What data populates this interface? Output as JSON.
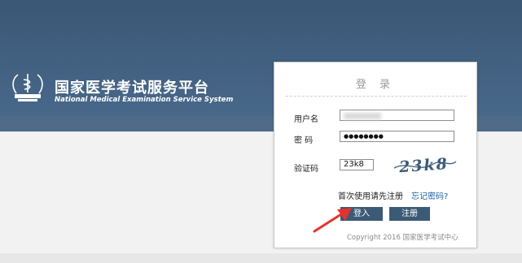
{
  "brand": {
    "name_cn": "国家医学考试服务平台",
    "name_en": "National Medical Examination Service System"
  },
  "login": {
    "title": "登 录",
    "username_label": "用户名",
    "password_label": "密 码",
    "password_value": "●●●●●●●●",
    "captcha_label": "验证码",
    "captcha_value": "23k8",
    "captcha_image_text": "23k8",
    "first_time_text": "首次使用请先注册",
    "forgot_link": "忘记密码?",
    "login_button": "登入",
    "register_button": "注册"
  },
  "footer": {
    "copyright": "Copyright 2016 国家医学考试中心"
  },
  "colors": {
    "header": "#3f5d7d",
    "button": "#3b5a75",
    "link": "#1f5fa3",
    "arrow": "#e5322d"
  }
}
